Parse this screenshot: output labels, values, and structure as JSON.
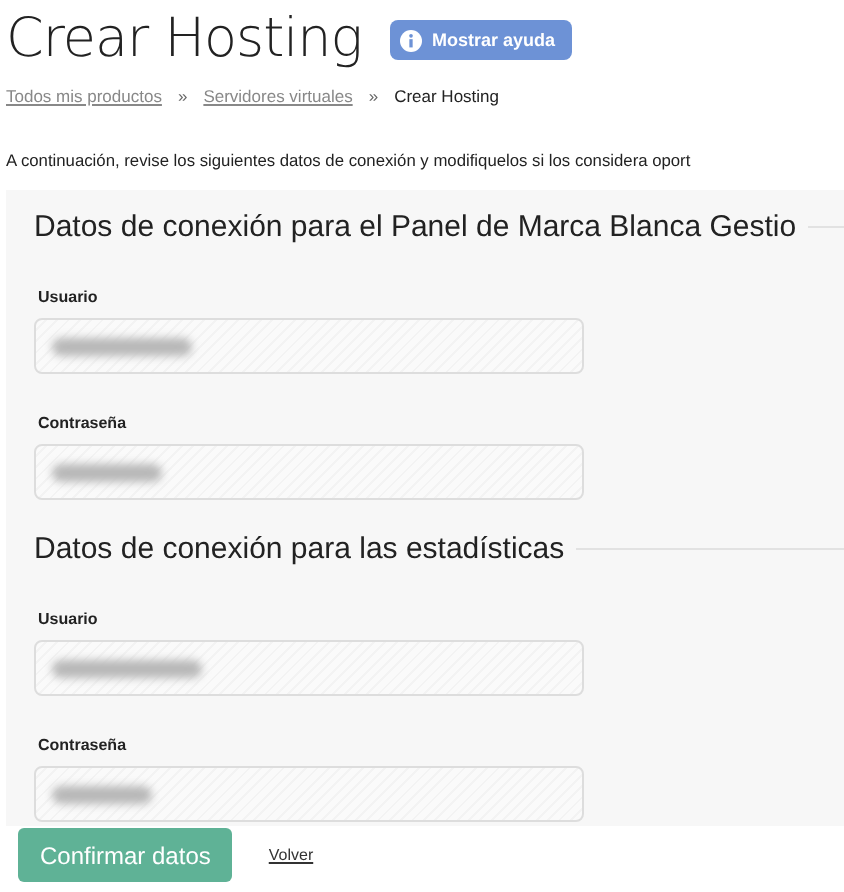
{
  "title": "Crear Hosting",
  "help_button": {
    "label": "Mostrar ayuda"
  },
  "breadcrumbs": [
    {
      "label": "Todos mis productos",
      "link": true
    },
    {
      "label": "Servidores virtuales",
      "link": true
    },
    {
      "label": "Crear Hosting",
      "link": false
    }
  ],
  "breadcrumb_separator": "»",
  "intro": "A continuación, revise los siguientes datos de conexión y modifiquelos si los considera oport",
  "sections": [
    {
      "heading": "Datos de conexión para el Panel de Marca Blanca Gestio",
      "fields": [
        {
          "label": "Usuario",
          "redacted": true
        },
        {
          "label": "Contraseña",
          "redacted": true
        }
      ]
    },
    {
      "heading": "Datos de conexión para las estadísticas",
      "fields": [
        {
          "label": "Usuario",
          "redacted": true
        },
        {
          "label": "Contraseña",
          "redacted": true
        }
      ]
    }
  ],
  "confirm_button": {
    "label": "Confirmar datos"
  },
  "back_link": {
    "label": "Volver"
  }
}
